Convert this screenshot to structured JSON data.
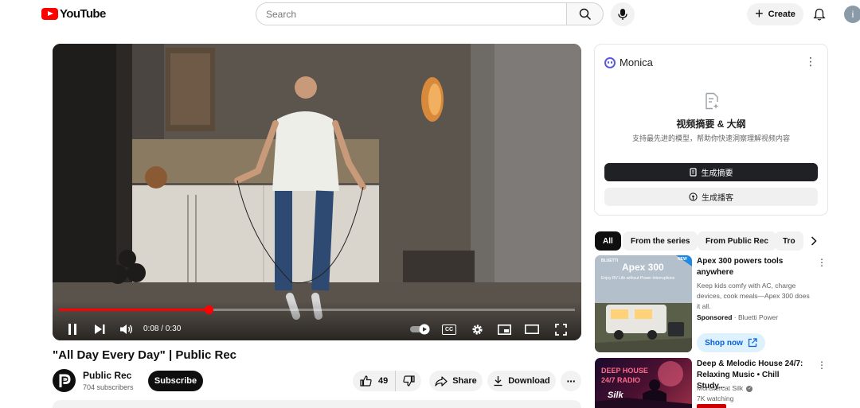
{
  "header": {
    "logo_text": "YouTube",
    "search_placeholder": "Search",
    "create_label": "Create",
    "avatar_letter": "i"
  },
  "player": {
    "time_display": "0:08 / 0:30",
    "progress_fraction": 0.29,
    "cc_label": "CC"
  },
  "video": {
    "title": "\"All Day Every Day\" | Public Rec",
    "channel_name": "Public Rec",
    "subscribers": "704 subscribers",
    "subscribe_label": "Subscribe",
    "like_count": "49",
    "share_label": "Share",
    "download_label": "Download",
    "more_label": "···"
  },
  "monica": {
    "name": "Monica",
    "title": "视频摘要 & 大纲",
    "subtitle": "支持最先进的模型，帮助你快速洞察理解视频内容",
    "primary_button": "生成摘要",
    "secondary_button": "生成播客"
  },
  "chips": [
    "All",
    "From the series",
    "From Public Rec",
    "Tro"
  ],
  "recommendations": {
    "ad": {
      "title": "Apex 300 powers tools anywhere",
      "description": "Keep kids comfy with AC, charge devices, cook meals—Apex 300 does it all.",
      "sponsored_label": "Sponsored",
      "advertiser": "Bluetti Power",
      "shop_label": "Shop now",
      "thumb_brand": "BLUETTI",
      "thumb_title": "Apex 300",
      "thumb_tagline": "Enjoy RV Life without Power Interruptions",
      "thumb_badge": "NEW"
    },
    "music": {
      "title": "Deep & Melodic House 24/7: Relaxing Music • Chill Study...",
      "channel": "Monstercat Silk",
      "watching": "7K watching",
      "thumb_line1": "DEEP HOUSE",
      "thumb_line2": "24/7 RADIO",
      "thumb_brand": "Silk"
    }
  },
  "colors": {
    "youtube_red": "#ff0000",
    "monica_purple": "#5a57e8",
    "shop_blue": "#065fd4"
  }
}
